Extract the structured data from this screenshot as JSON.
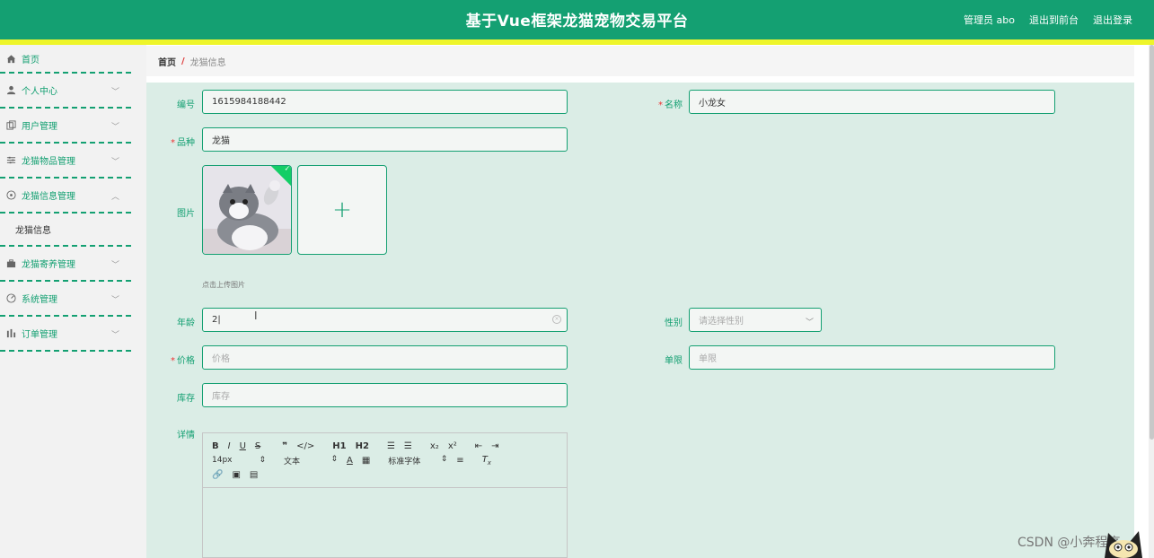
{
  "header": {
    "title": "基于Vue框架龙猫宠物交易平台",
    "user": "管理员 abo",
    "exit_front": "退出到前台",
    "logout": "退出登录"
  },
  "sidebar": {
    "home": "首页",
    "items": [
      {
        "label": "个人中心",
        "icon": "user-icon"
      },
      {
        "label": "用户管理",
        "icon": "users-icon"
      },
      {
        "label": "龙猫物品管理",
        "icon": "sliders-icon"
      },
      {
        "label": "龙猫信息管理",
        "icon": "compass-icon",
        "expanded": true,
        "sub": [
          "龙猫信息"
        ]
      },
      {
        "label": "龙猫寄养管理",
        "icon": "briefcase-icon"
      },
      {
        "label": "系统管理",
        "icon": "gauge-icon"
      },
      {
        "label": "订单管理",
        "icon": "chart-icon"
      }
    ]
  },
  "breadcrumb": {
    "home": "首页",
    "separator": "/",
    "current": "龙猫信息"
  },
  "form": {
    "number_label": "编号",
    "number_value": "1615984188442",
    "name_label": "名称",
    "name_value": "小龙女",
    "breed_label": "品种",
    "breed_value": "龙猫",
    "picture_label": "图片",
    "upload_hint": "点击上传图片",
    "age_label": "年龄",
    "age_value": "2",
    "gender_label": "性别",
    "gender_placeholder": "请选择性别",
    "price_label": "价格",
    "price_placeholder": "价格",
    "limit_label": "单限",
    "limit_placeholder": "单限",
    "stock_label": "库存",
    "stock_placeholder": "库存",
    "detail_label": "详情"
  },
  "editor": {
    "font_size": "14px",
    "text_style": "文本",
    "font_family": "标准字体",
    "h1": "H1",
    "h2": "H2",
    "sub": "x₂",
    "sup": "x²"
  },
  "watermark": "CSDN @小奔程序",
  "colors": {
    "brand": "#14a072",
    "accent_strip": "#eef52a",
    "content_bg": "#dbede6"
  }
}
